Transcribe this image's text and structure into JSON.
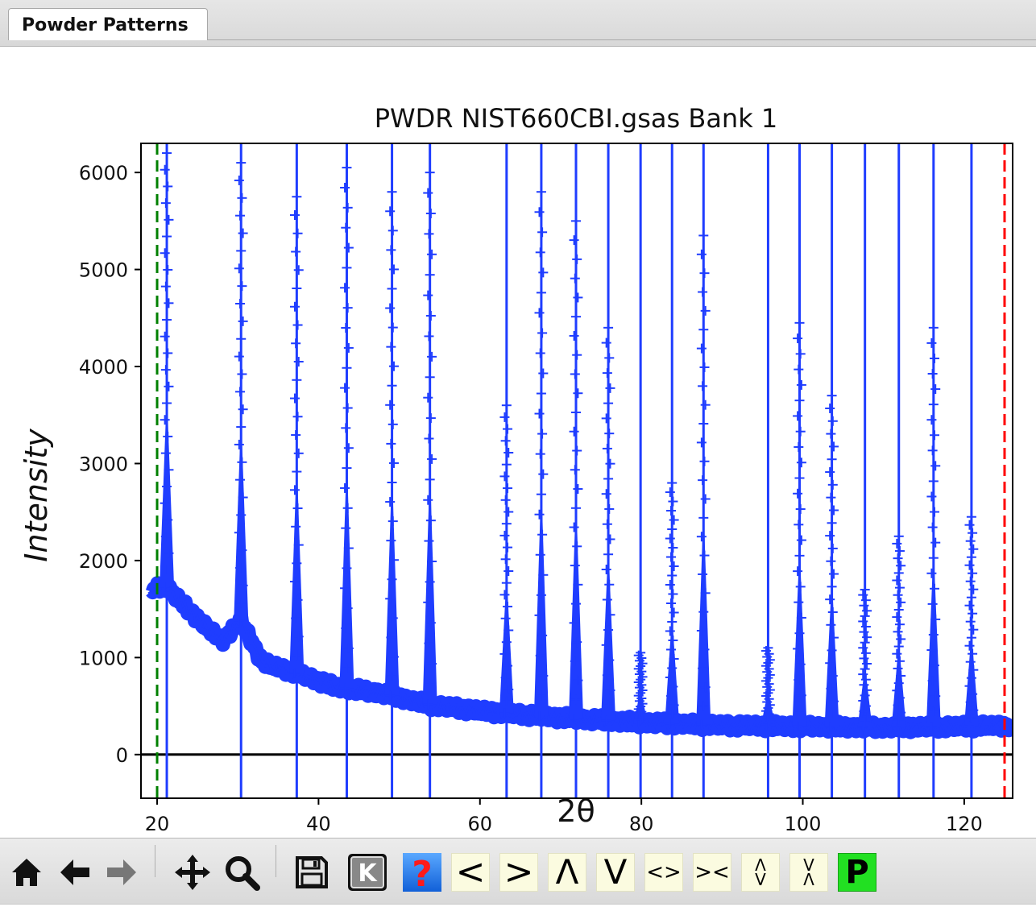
{
  "tabs": {
    "active": "Powder Patterns"
  },
  "chart_data": {
    "type": "scatter",
    "title": "PWDR NIST660CBI.gsas Bank 1",
    "xlabel": "2θ",
    "ylabel": "Intensity",
    "xlim": [
      18,
      126
    ],
    "ylim": [
      -450,
      6300
    ],
    "xticks": [
      20,
      40,
      60,
      80,
      100,
      120
    ],
    "yticks": [
      0,
      1000,
      2000,
      3000,
      4000,
      5000,
      6000
    ],
    "grid": false,
    "colors": {
      "observed": "#1f3dff",
      "reflections": "#1f3dff",
      "lower_limit": "#008000",
      "upper_limit": "#ff0000",
      "zero_line": "#000000"
    },
    "lower_limit": 20.0,
    "upper_limit": 125.0,
    "reflection_positions": [
      21.2,
      30.4,
      37.3,
      43.5,
      49.1,
      53.8,
      63.3,
      67.6,
      71.9,
      75.9,
      79.9,
      83.8,
      87.7,
      95.7,
      99.6,
      103.6,
      107.7,
      111.9,
      116.2,
      120.9
    ],
    "peaks": [
      {
        "x": 21.2,
        "max": 6200
      },
      {
        "x": 30.4,
        "max": 6100
      },
      {
        "x": 37.3,
        "max": 5750
      },
      {
        "x": 43.5,
        "max": 6050
      },
      {
        "x": 49.1,
        "max": 5800
      },
      {
        "x": 53.8,
        "max": 6000
      },
      {
        "x": 63.3,
        "max": 3600
      },
      {
        "x": 67.6,
        "max": 5800
      },
      {
        "x": 71.9,
        "max": 5500
      },
      {
        "x": 75.9,
        "max": 4400
      },
      {
        "x": 79.9,
        "max": 1050
      },
      {
        "x": 83.8,
        "max": 2800
      },
      {
        "x": 87.7,
        "max": 5350
      },
      {
        "x": 95.7,
        "max": 1100
      },
      {
        "x": 99.6,
        "max": 4450
      },
      {
        "x": 103.6,
        "max": 3700
      },
      {
        "x": 107.7,
        "max": 1700
      },
      {
        "x": 111.9,
        "max": 2250
      },
      {
        "x": 116.2,
        "max": 4400
      },
      {
        "x": 120.9,
        "max": 2450
      }
    ],
    "background": [
      {
        "x": 19.5,
        "y": 1700
      },
      {
        "x": 21,
        "y": 1750
      },
      {
        "x": 24,
        "y": 1480
      },
      {
        "x": 28,
        "y": 1170
      },
      {
        "x": 30.4,
        "y": 1380
      },
      {
        "x": 33,
        "y": 950
      },
      {
        "x": 38,
        "y": 820
      },
      {
        "x": 42,
        "y": 700
      },
      {
        "x": 48,
        "y": 630
      },
      {
        "x": 54,
        "y": 510
      },
      {
        "x": 60,
        "y": 450
      },
      {
        "x": 70,
        "y": 380
      },
      {
        "x": 80,
        "y": 330
      },
      {
        "x": 90,
        "y": 300
      },
      {
        "x": 100,
        "y": 290
      },
      {
        "x": 110,
        "y": 280
      },
      {
        "x": 120,
        "y": 290
      },
      {
        "x": 126,
        "y": 300
      }
    ]
  },
  "toolbar": {
    "icons": [
      "home-icon",
      "back-arrow-icon",
      "forward-arrow-icon",
      "pan-icon",
      "zoom-icon",
      "save-icon",
      "k-icon",
      "help-icon"
    ],
    "btn_left": "<",
    "btn_right": ">",
    "btn_up": "Λ",
    "btn_down": "V",
    "btn_expand_h": "<>",
    "btn_shrink_h": "><",
    "btn_expand_v_top": "Λ",
    "btn_expand_v_bot": "V",
    "btn_shrink_v_top": "V",
    "btn_shrink_v_bot": "Λ",
    "btn_p": "P",
    "help_glyph": "?",
    "k_glyph": "K"
  }
}
